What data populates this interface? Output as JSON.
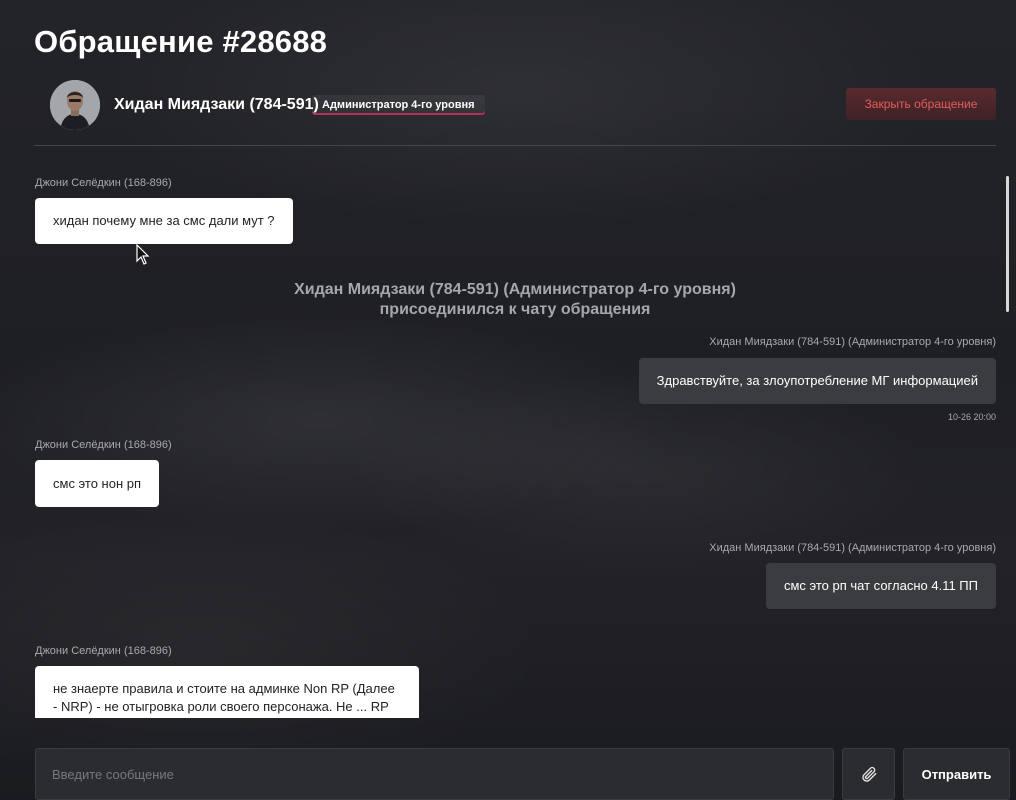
{
  "ticket": {
    "title": "Обращение #28688"
  },
  "admin": {
    "name": "Хидан Миядзаки (784-591)",
    "rank": "Администратор 4-го уровня",
    "close_label": "Закрыть обращение"
  },
  "messages": [
    {
      "author": "Джони Селёдкин (168-896)",
      "text": "хидан почему мне за смс дали мут ?",
      "side": "in"
    },
    {
      "system": [
        "Хидан Миядзаки (784-591) (Администратор 4-го уровня)",
        "присоединился к чату обращения"
      ]
    },
    {
      "author": "Хидан Миядзаки (784-591) (Администратор 4-го уровня)",
      "text": "Здравствуйте, за злоупотребление МГ информацией",
      "side": "out",
      "time": "10-26 20:00"
    },
    {
      "author": "Джони Селёдкин (168-896)",
      "text": "смс это нон рп",
      "side": "in"
    },
    {
      "author": "Хидан Миядзаки (784-591) (Администратор 4-го уровня)",
      "text": "смс это рп чат согласно 4.11 ПП",
      "side": "out"
    },
    {
      "author": "Джони Селёдкин (168-896)",
      "text": "не знаерте правила и стоите на админке Non RP (Далее - NRP) - не отыгровка роли своего персонажа. Не ... RP ...",
      "side": "in"
    }
  ],
  "composer": {
    "placeholder": "Введите сообщение",
    "send_label": "Отправить"
  },
  "icons": {
    "attach": "paperclip-icon",
    "cursor": "mouse-pointer-icon",
    "avatar": "user-avatar"
  },
  "colors": {
    "background": "#1c1d21",
    "incoming_bubble": "#ffffff",
    "outgoing_bubble": "#3b3c40",
    "close_button_text": "#e35d5d",
    "rank_underline": "#b2315a"
  }
}
